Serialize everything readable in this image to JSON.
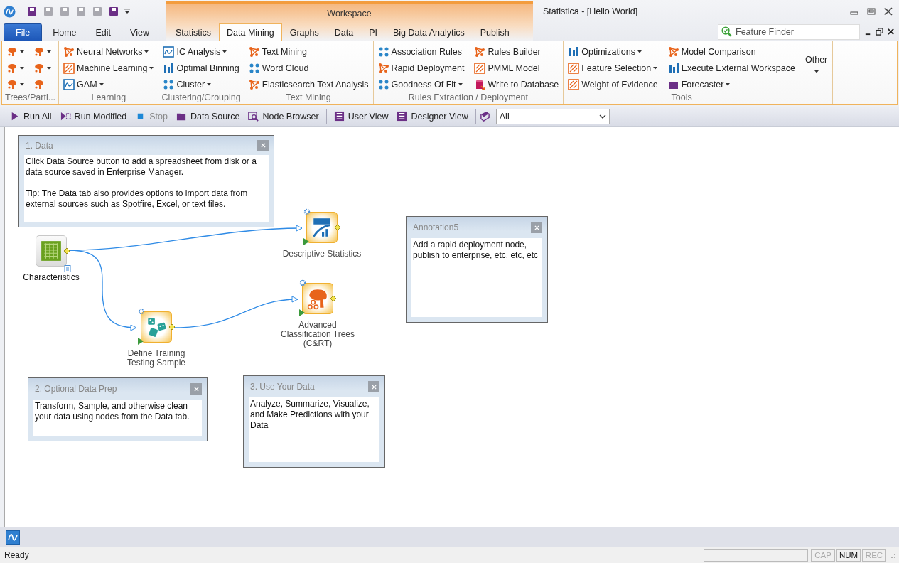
{
  "window": {
    "title": "Statistica - [Hello World]"
  },
  "quick_access": [
    {
      "disabled": false
    },
    {
      "disabled": true
    },
    {
      "disabled": true
    },
    {
      "disabled": true
    },
    {
      "disabled": true
    },
    {
      "disabled": false
    }
  ],
  "contextual_group": "Workspace",
  "tabs": [
    {
      "label": "File",
      "kind": "file",
      "selected": false
    },
    {
      "label": "Home",
      "kind": "plain",
      "selected": false
    },
    {
      "label": "Edit",
      "kind": "plain",
      "selected": false
    },
    {
      "label": "View",
      "kind": "plain",
      "selected": false
    },
    {
      "label": "Statistics",
      "kind": "contextual",
      "selected": false
    },
    {
      "label": "Data Mining",
      "kind": "contextual",
      "selected": true
    },
    {
      "label": "Graphs",
      "kind": "contextual",
      "selected": false
    },
    {
      "label": "Data",
      "kind": "contextual",
      "selected": false
    },
    {
      "label": "PI",
      "kind": "contextual",
      "selected": false
    },
    {
      "label": "Big Data Analytics",
      "kind": "contextual",
      "selected": false
    },
    {
      "label": "Publish",
      "kind": "contextual",
      "selected": false
    }
  ],
  "feature_finder": {
    "placeholder": "Feature Finder"
  },
  "ribbon_groups": [
    {
      "label": "Trees/Parti...",
      "kind": "icons",
      "items": [
        {
          "dropdown": true
        },
        {
          "dropdown": true
        },
        {
          "dropdown": true
        },
        {
          "dropdown": true
        },
        {
          "dropdown": true
        },
        {
          "dropdown": false
        }
      ]
    },
    {
      "label": "Learning",
      "kind": "list",
      "items": [
        {
          "label": "Neural Networks",
          "dropdown": true
        },
        {
          "label": "Machine Learning",
          "dropdown": true
        },
        {
          "label": "GAM",
          "dropdown": true
        }
      ]
    },
    {
      "label": "Clustering/Grouping",
      "kind": "list",
      "items": [
        {
          "label": "IC Analysis",
          "dropdown": true
        },
        {
          "label": "Optimal Binning",
          "dropdown": false
        },
        {
          "label": "Cluster",
          "dropdown": true
        }
      ]
    },
    {
      "label": "Text Mining",
      "kind": "list",
      "items": [
        {
          "label": "Text Mining",
          "dropdown": false
        },
        {
          "label": "Word Cloud",
          "dropdown": false
        },
        {
          "label": "Elasticsearch Text Analysis",
          "dropdown": false
        }
      ]
    },
    {
      "label": "Rules Extraction / Deployment",
      "kind": "list",
      "items": [
        {
          "label": "Association Rules",
          "dropdown": false
        },
        {
          "label": "Rapid Deployment",
          "dropdown": false
        },
        {
          "label": "Goodness Of Fit",
          "dropdown": true
        },
        {
          "label": "Rules Builder",
          "dropdown": false
        },
        {
          "label": "PMML Model",
          "dropdown": false
        },
        {
          "label": "Write to Database",
          "dropdown": false
        }
      ]
    },
    {
      "label": "Tools",
      "kind": "list",
      "items": [
        {
          "label": "Optimizations",
          "dropdown": true
        },
        {
          "label": "Feature Selection",
          "dropdown": true
        },
        {
          "label": "Weight of Evidence",
          "dropdown": false
        },
        {
          "label": "Model Comparison",
          "dropdown": false
        },
        {
          "label": "Execute External Workspace",
          "dropdown": false
        },
        {
          "label": "Forecaster",
          "dropdown": true
        }
      ]
    },
    {
      "label": "Other",
      "kind": "big"
    }
  ],
  "toolbar_groups": [
    [
      {
        "label": "Run All",
        "disabled": false
      },
      {
        "label": "Run Modified",
        "disabled": false
      },
      {
        "label": "Stop",
        "disabled": true
      },
      {
        "label": "Data Source",
        "disabled": false
      },
      {
        "label": "Node Browser",
        "disabled": false
      }
    ],
    [
      {
        "label": "User View",
        "disabled": false
      },
      {
        "label": "Designer View",
        "disabled": false
      }
    ]
  ],
  "view_filter": {
    "value": "All"
  },
  "annotations": [
    {
      "title": "1. Data",
      "paragraphs": [
        "Click Data Source button to add a spreadsheet from disk or a data source saved in Enterprise Manager.",
        "Tip:  The Data tab also provides options to import data from external sources such as Spotfire, Excel, or text files."
      ]
    },
    {
      "title": "Annotation5",
      "paragraphs": [
        "Add a rapid deployment node, publish to enterprise, etc, etc, etc"
      ]
    },
    {
      "title": "2. Optional Data Prep",
      "paragraphs": [
        "Transform, Sample, and otherwise clean your data using nodes from the Data tab."
      ]
    },
    {
      "title": "3. Use Your Data",
      "paragraphs": [
        "Analyze, Summarize, Visualize, and Make Predictions with your Data"
      ]
    }
  ],
  "nodes": [
    {
      "label": "Characteristics",
      "kind": "data"
    },
    {
      "label": "Descriptive Statistics",
      "kind": "analysis"
    },
    {
      "label": "Define Training\nTesting Sample",
      "kind": "analysis"
    },
    {
      "label": "Advanced\nClassification Trees\n(C&RT)",
      "kind": "analysis"
    }
  ],
  "status_bar": {
    "text": "Ready",
    "indicators": [
      {
        "label": "CAP",
        "on": false
      },
      {
        "label": "NUM",
        "on": true
      },
      {
        "label": "REC",
        "on": false
      }
    ]
  }
}
